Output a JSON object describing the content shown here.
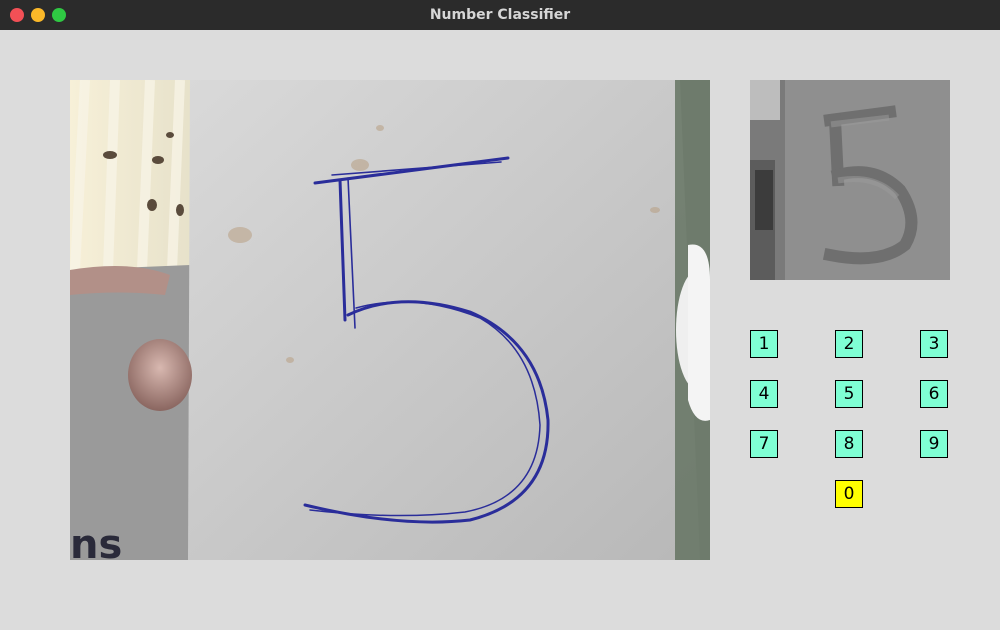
{
  "window": {
    "title": "Number Classifier"
  },
  "camera": {
    "handwritten_digit": "5"
  },
  "preview": {
    "digit": "5"
  },
  "digits": {
    "labels": [
      "1",
      "2",
      "3",
      "4",
      "5",
      "6",
      "7",
      "8",
      "9",
      "0"
    ],
    "predicted": "0",
    "colors": {
      "default": "#7fffd4",
      "predicted": "#ffff00"
    }
  }
}
